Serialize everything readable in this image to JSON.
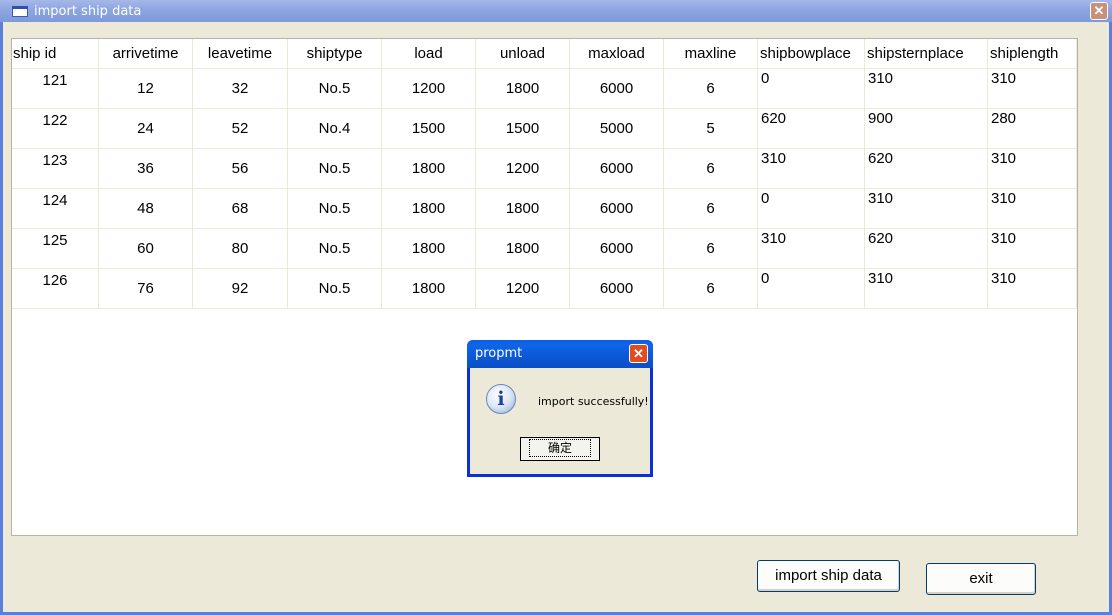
{
  "window": {
    "title": "import ship data",
    "close_label": "✕"
  },
  "table": {
    "columns": [
      "ship id",
      "arrivetime",
      "leavetime",
      "shiptype",
      "load",
      "unload",
      "maxload",
      "maxline",
      "shipbowplace",
      "shipsternplace",
      "shiplength"
    ],
    "rows": [
      [
        "121",
        "12",
        "32",
        "No.5",
        "1200",
        "1800",
        "6000",
        "6",
        "0",
        "310",
        "310"
      ],
      [
        "122",
        "24",
        "52",
        "No.4",
        "1500",
        "1500",
        "5000",
        "5",
        "620",
        "900",
        "280"
      ],
      [
        "123",
        "36",
        "56",
        "No.5",
        "1800",
        "1200",
        "6000",
        "6",
        "310",
        "620",
        "310"
      ],
      [
        "124",
        "48",
        "68",
        "No.5",
        "1800",
        "1800",
        "6000",
        "6",
        "0",
        "310",
        "310"
      ],
      [
        "125",
        "60",
        "80",
        "No.5",
        "1800",
        "1800",
        "6000",
        "6",
        "310",
        "620",
        "310"
      ],
      [
        "126",
        "76",
        "92",
        "No.5",
        "1800",
        "1200",
        "6000",
        "6",
        "0",
        "310",
        "310"
      ]
    ]
  },
  "buttons": {
    "import": "import ship data",
    "exit": "exit"
  },
  "dialog": {
    "title": "propmt",
    "close_label": "✕",
    "icon": "info-icon",
    "icon_glyph": "i",
    "message": "import successfully!",
    "ok_label": "确定"
  },
  "colors": {
    "title_bar": "#8ea7e2",
    "dialog_title_bar": "#0c58d6",
    "window_bg": "#ece9d8"
  }
}
